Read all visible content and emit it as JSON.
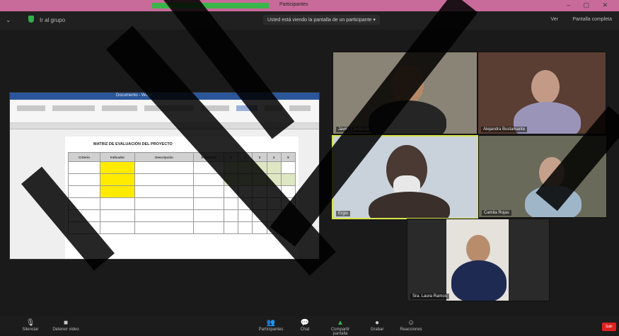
{
  "window": {
    "tab_text": "Participantes",
    "controls": "– ▢ ✕"
  },
  "topbar": {
    "info_label": "Ir al grupo",
    "banner": "Usted está viendo la pantalla de un participante ▾",
    "view_label": "Ver",
    "fullscreen_label": "Pantalla completa"
  },
  "shared_doc": {
    "title_bar": "Documento - Word",
    "heading": "MATRIZ DE EVALUACIÓN DEL PROYECTO",
    "col_headers": [
      "Criterio",
      "Indicador",
      "Descripción",
      "Evidencia",
      "1",
      "2",
      "3",
      "4",
      "5"
    ]
  },
  "participants": [
    {
      "name": "Javier Cárdenas"
    },
    {
      "name": "Alejandra Bustamante"
    },
    {
      "name": "Ergio"
    },
    {
      "name": "Camila Rojas"
    },
    {
      "name": "Sra. Laura Ramos"
    }
  ],
  "toolbar": {
    "mute": "Silenciar",
    "video": "Detener video",
    "participants": "Participantes",
    "chat": "Chat",
    "share": "Compartir pantalla",
    "record": "Grabar",
    "reactions": "Reacciones",
    "end": "Salir"
  },
  "colors": {
    "accent_green": "#2fb04b",
    "end_red": "#e02020",
    "active_speaker": "#d8e34b"
  }
}
